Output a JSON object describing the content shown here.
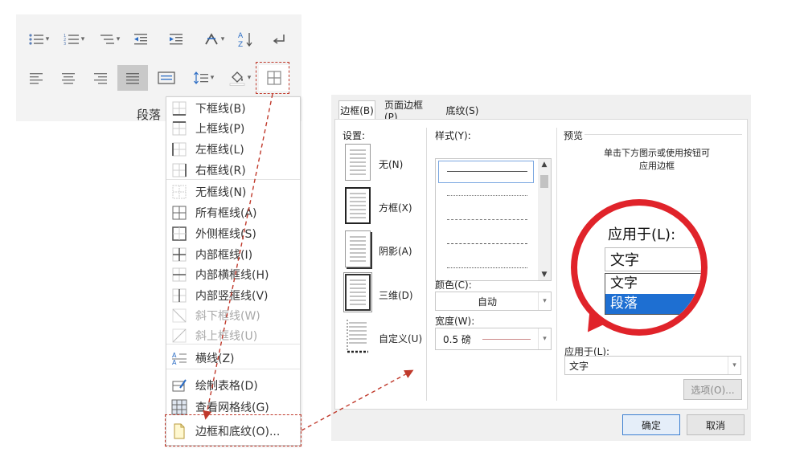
{
  "ribbon": {
    "group_label": "段落",
    "az_label": "A↓Z"
  },
  "menu": {
    "items": [
      {
        "label": "下框线(B)",
        "icon": "border-bottom-icon",
        "disabled": false
      },
      {
        "label": "上框线(P)",
        "icon": "border-top-icon",
        "disabled": false
      },
      {
        "label": "左框线(L)",
        "icon": "border-left-icon",
        "disabled": false
      },
      {
        "label": "右框线(R)",
        "icon": "border-right-icon",
        "disabled": false
      },
      {
        "label": "无框线(N)",
        "icon": "border-none-icon",
        "disabled": false
      },
      {
        "label": "所有框线(A)",
        "icon": "border-all-icon",
        "disabled": false
      },
      {
        "label": "外侧框线(S)",
        "icon": "border-outside-icon",
        "disabled": false
      },
      {
        "label": "内部框线(I)",
        "icon": "border-inside-icon",
        "disabled": false
      },
      {
        "label": "内部横框线(H)",
        "icon": "border-inside-horizontal-icon",
        "disabled": false
      },
      {
        "label": "内部竖框线(V)",
        "icon": "border-inside-vertical-icon",
        "disabled": false
      },
      {
        "label": "斜下框线(W)",
        "icon": "diagonal-down-icon",
        "disabled": true
      },
      {
        "label": "斜上框线(U)",
        "icon": "diagonal-up-icon",
        "disabled": true
      },
      {
        "label": "横线(Z)",
        "icon": "horizontal-line-icon",
        "disabled": false
      },
      {
        "label": "绘制表格(D)",
        "icon": "draw-table-icon",
        "disabled": false
      },
      {
        "label": "查看网格线(G)",
        "icon": "view-gridlines-icon",
        "disabled": false
      },
      {
        "label": "边框和底纹(O)...",
        "icon": "page-icon",
        "disabled": false
      }
    ]
  },
  "dialog": {
    "tabs": [
      "边框(B)",
      "页面边框(P)",
      "底纹(S)"
    ],
    "settings_label": "设置:",
    "settings": [
      "无(N)",
      "方框(X)",
      "阴影(A)",
      "三维(D)",
      "自定义(U)"
    ],
    "style_label": "样式(Y):",
    "color_label": "颜色(C):",
    "color_value": "自动",
    "width_label": "宽度(W):",
    "width_value": "0.5 磅",
    "preview_label": "预览",
    "preview_hint_1": "单击下方图示或使用按钮可",
    "preview_hint_2": "应用边框",
    "apply_label": "应用于(L):",
    "apply_value": "文字",
    "options_button": "选项(O)...",
    "ok_button": "确定",
    "cancel_button": "取消"
  },
  "magnifier": {
    "title": "应用于(L):",
    "field_value": "文字",
    "options": [
      "文字",
      "段落"
    ],
    "selected_index": 1
  },
  "colors": {
    "accent_red": "#e0232a",
    "dashed_red": "#c0392b",
    "selection_blue": "#1e6fd2",
    "ribbon_bg": "#f3f3f3"
  }
}
